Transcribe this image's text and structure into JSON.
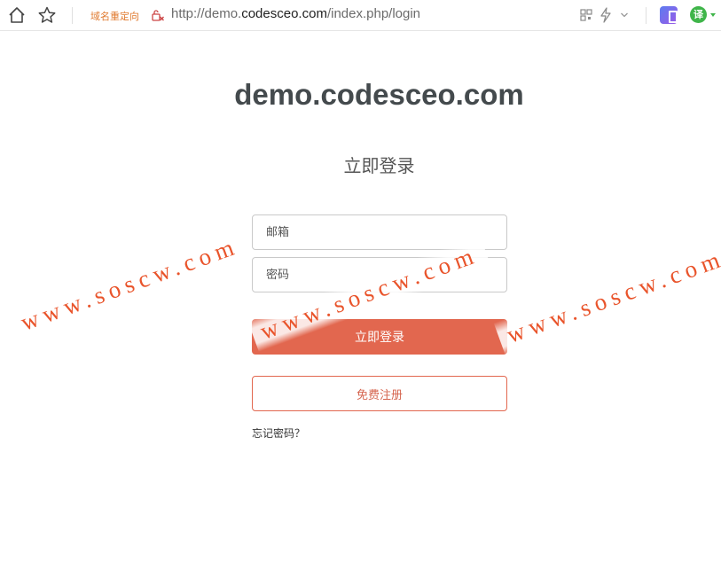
{
  "browser": {
    "redirect_tag": "域名重定向",
    "url_prefix": "http://demo.",
    "url_host": "codesceo.com",
    "url_path": "/index.php/login",
    "translate_label": "译"
  },
  "page": {
    "site_title": "demo.codesceo.com",
    "login_heading": "立即登录",
    "email_placeholder": "邮箱",
    "password_placeholder": "密码",
    "login_button": "立即登录",
    "register_button": "免费注册",
    "forgot_link": "忘记密码？"
  },
  "watermark": {
    "text": "www.soscw.com"
  },
  "colors": {
    "accent": "#e2674f",
    "title": "#444a4d",
    "watermark": "#e9542b"
  }
}
